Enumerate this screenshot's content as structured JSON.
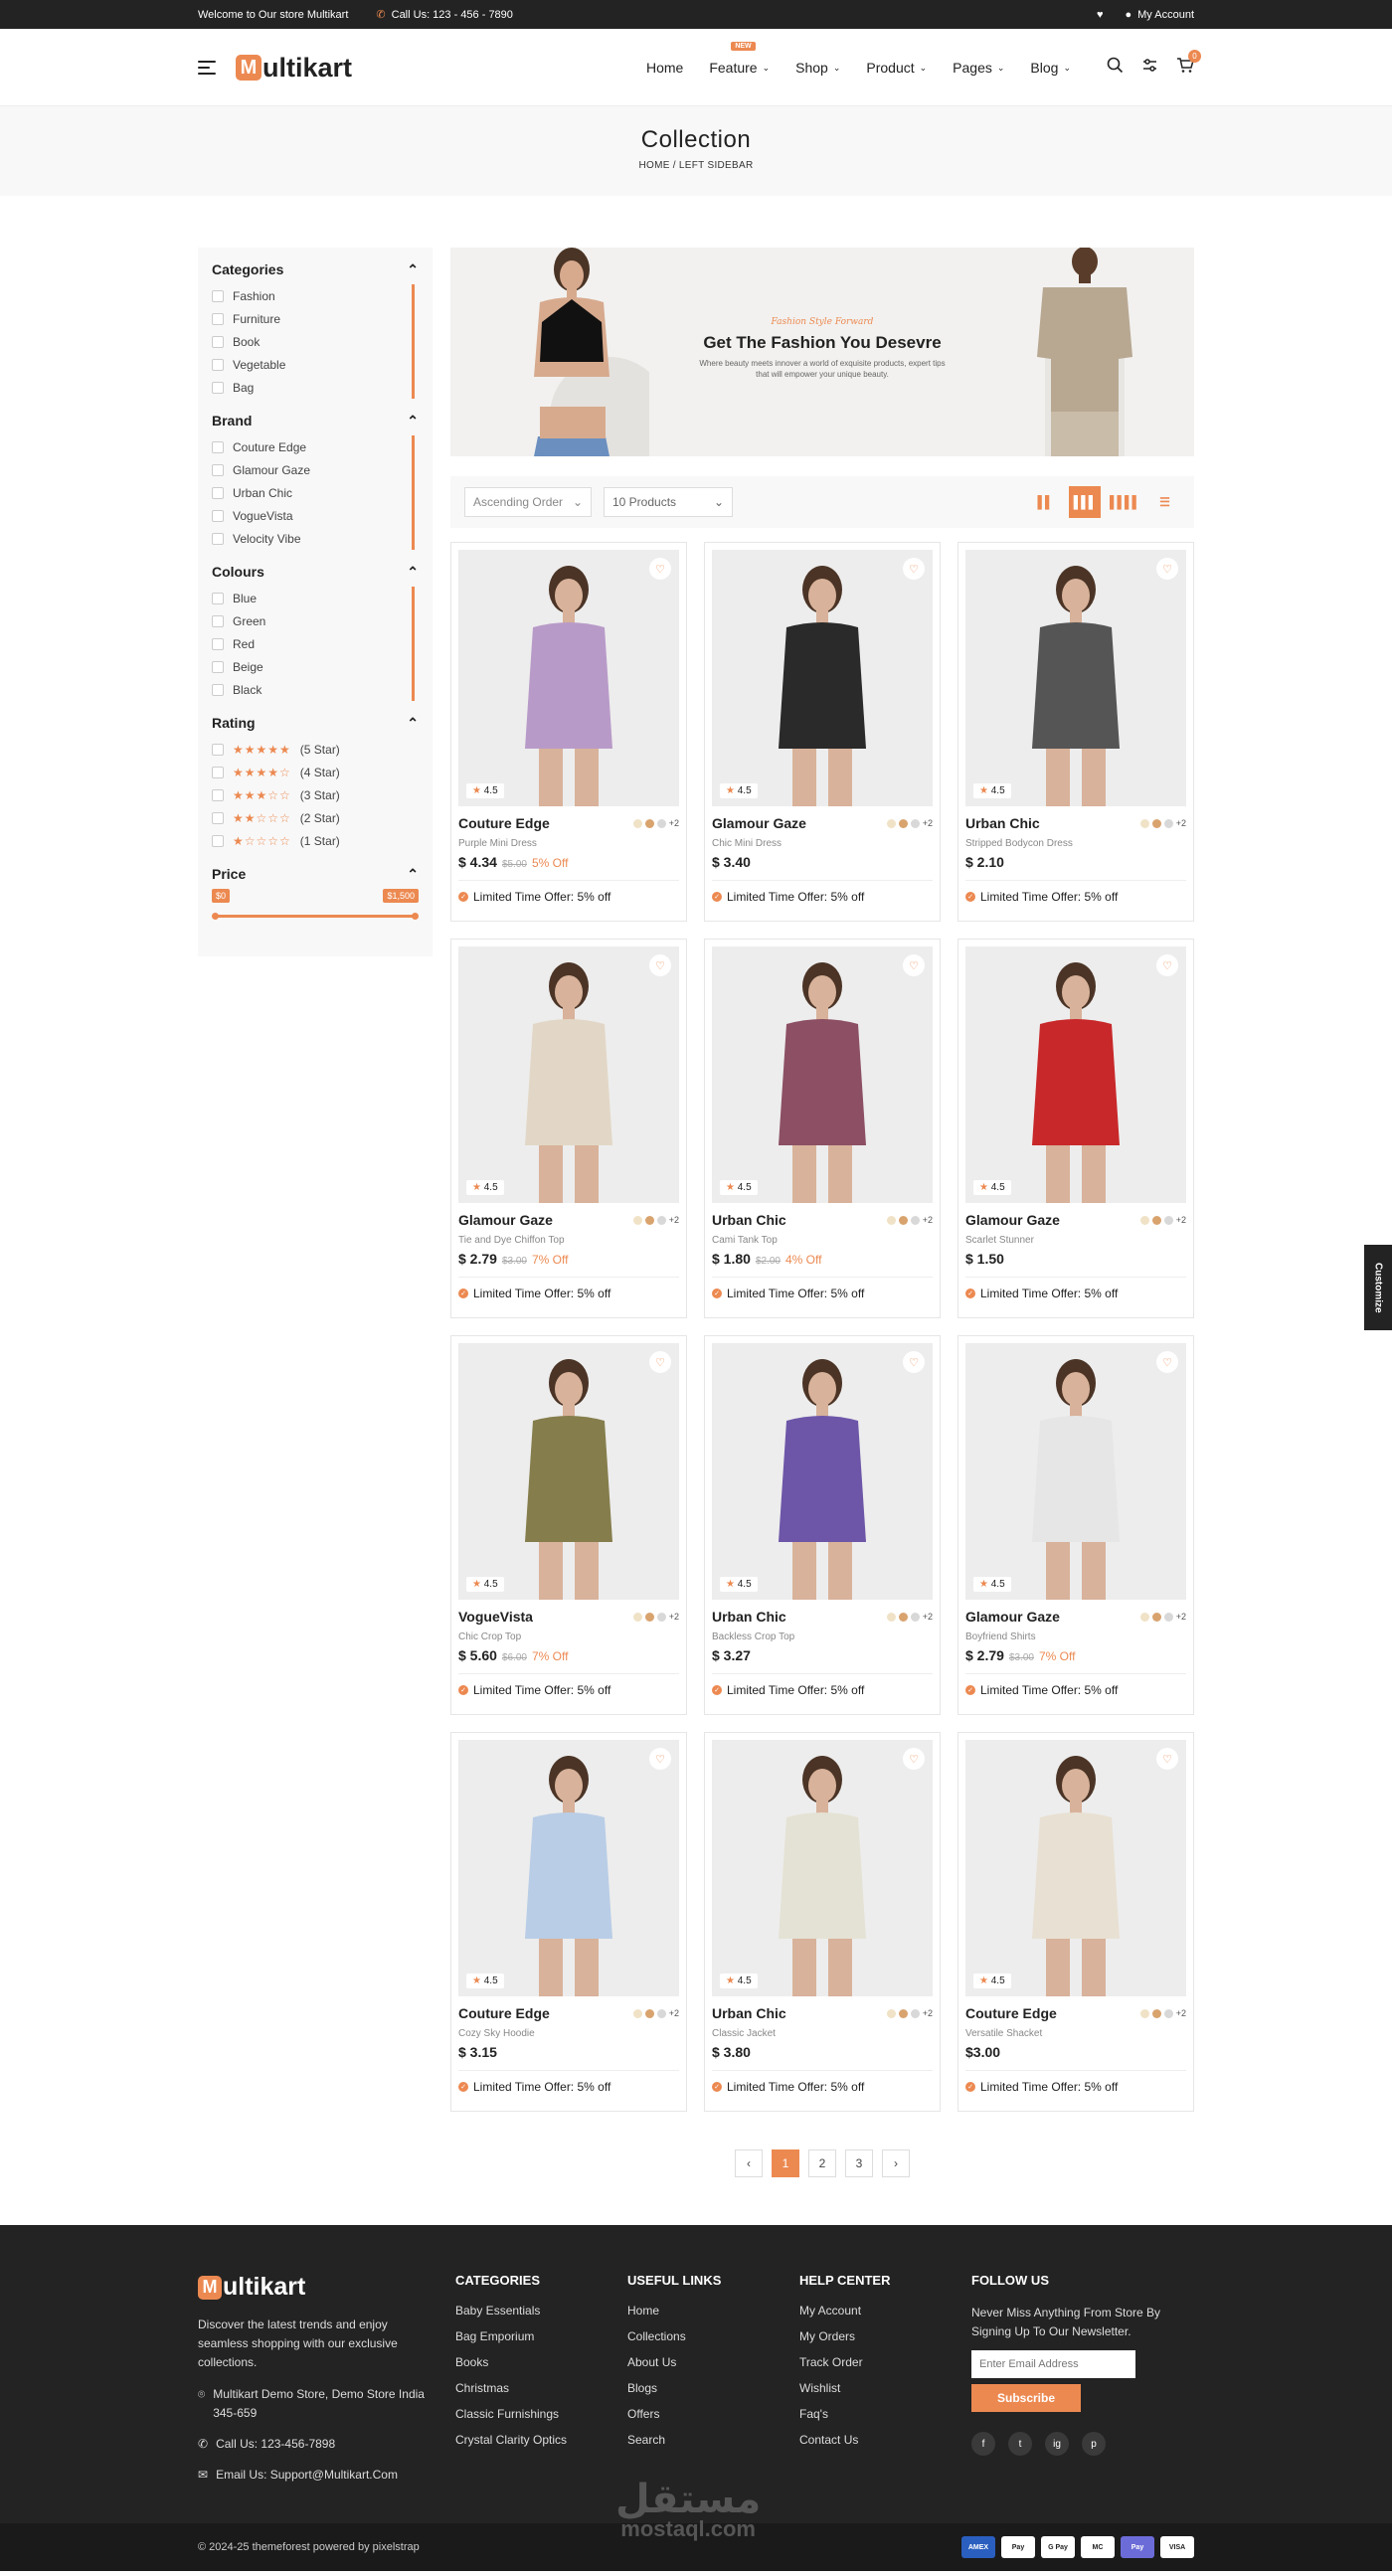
{
  "topbar": {
    "welcome": "Welcome to Our store Multikart",
    "phone": "Call Us: 123 - 456 - 7890",
    "account": "My Account"
  },
  "header": {
    "logo_rest": "ultikart",
    "nav": [
      {
        "label": "Home",
        "chevron": false,
        "badge": ""
      },
      {
        "label": "Feature",
        "chevron": true,
        "badge": "NEW"
      },
      {
        "label": "Shop",
        "chevron": true,
        "badge": ""
      },
      {
        "label": "Product",
        "chevron": true,
        "badge": ""
      },
      {
        "label": "Pages",
        "chevron": true,
        "badge": ""
      },
      {
        "label": "Blog",
        "chevron": true,
        "badge": ""
      }
    ],
    "cart_count": "0"
  },
  "page": {
    "title": "Collection",
    "breadcrumb": "HOME  /  LEFT SIDEBAR"
  },
  "filters": {
    "categories": {
      "title": "Categories",
      "items": [
        "Fashion",
        "Furniture",
        "Book",
        "Vegetable",
        "Bag"
      ]
    },
    "brand": {
      "title": "Brand",
      "items": [
        "Couture Edge",
        "Glamour Gaze",
        "Urban Chic",
        "VogueVista",
        "Velocity Vibe"
      ]
    },
    "colours": {
      "title": "Colours",
      "items": [
        "Blue",
        "Green",
        "Red",
        "Beige",
        "Black"
      ]
    },
    "rating": {
      "title": "Rating",
      "items": [
        {
          "stars": 5,
          "label": "(5 Star)"
        },
        {
          "stars": 4,
          "label": "(4 Star)"
        },
        {
          "stars": 3,
          "label": "(3 Star)"
        },
        {
          "stars": 2,
          "label": "(2 Star)"
        },
        {
          "stars": 1,
          "label": "(1 Star)"
        }
      ]
    },
    "price": {
      "title": "Price",
      "min": "$0",
      "max": "$1,500"
    }
  },
  "banner": {
    "script": "Fashion Style Forward",
    "title": "Get The Fashion You Desevre",
    "text": "Where beauty meets innover a world of exquisite products, expert tips that will empower your unique beauty."
  },
  "toolbar": {
    "sort": "Ascending Order",
    "count": "10 Products"
  },
  "products": [
    {
      "brand": "Couture Edge",
      "name": "Purple Mini Dress",
      "price": "$ 4.34",
      "old": "$5.00",
      "off": "5% Off",
      "rating": "4.5",
      "bg": "#b89ac8",
      "more": "+2",
      "offer": "Limited Time Offer: 5% off"
    },
    {
      "brand": "Glamour Gaze",
      "name": "Chic Mini Dress",
      "price": "$ 3.40",
      "old": "",
      "off": "",
      "rating": "4.5",
      "bg": "#2a2a2a",
      "more": "+2",
      "offer": "Limited Time Offer: 5% off"
    },
    {
      "brand": "Urban Chic",
      "name": "Stripped Bodycon Dress",
      "price": "$ 2.10",
      "old": "",
      "off": "",
      "rating": "4.5",
      "bg": "#555555",
      "more": "+2",
      "offer": "Limited Time Offer: 5% off"
    },
    {
      "brand": "Glamour Gaze",
      "name": "Tie and Dye Chiffon Top",
      "price": "$ 2.79",
      "old": "$3.00",
      "off": "7% Off",
      "rating": "4.5",
      "bg": "#e2d7c6",
      "more": "+2",
      "offer": "Limited Time Offer: 5% off"
    },
    {
      "brand": "Urban Chic",
      "name": "Cami Tank Top",
      "price": "$ 1.80",
      "old": "$2.00",
      "off": "4% Off",
      "rating": "4.5",
      "bg": "#8c4f63",
      "more": "+2",
      "offer": "Limited Time Offer: 5% off"
    },
    {
      "brand": "Glamour Gaze",
      "name": "Scarlet Stunner",
      "price": "$ 1.50",
      "old": "",
      "off": "",
      "rating": "4.5",
      "bg": "#c8282a",
      "more": "+2",
      "offer": "Limited Time Offer: 5% off"
    },
    {
      "brand": "VogueVista",
      "name": "Chic Crop Top",
      "price": "$ 5.60",
      "old": "$6.00",
      "off": "7% Off",
      "rating": "4.5",
      "bg": "#857d4c",
      "more": "+2",
      "offer": "Limited Time Offer: 5% off"
    },
    {
      "brand": "Urban Chic",
      "name": "Backless Crop Top",
      "price": "$ 3.27",
      "old": "",
      "off": "",
      "rating": "4.5",
      "bg": "#6d56a8",
      "more": "+2",
      "offer": "Limited Time Offer: 5% off"
    },
    {
      "brand": "Glamour Gaze",
      "name": "Boyfriend Shirts",
      "price": "$ 2.79",
      "old": "$3.00",
      "off": "7% Off",
      "rating": "4.5",
      "bg": "#e6e6e6",
      "more": "+2",
      "offer": "Limited Time Offer: 5% off"
    },
    {
      "brand": "Couture Edge",
      "name": "Cozy Sky Hoodie",
      "price": "$ 3.15",
      "old": "",
      "off": "",
      "rating": "4.5",
      "bg": "#b9cde6",
      "more": "+2",
      "offer": "Limited Time Offer: 5% off"
    },
    {
      "brand": "Urban Chic",
      "name": "Classic Jacket",
      "price": "$ 3.80",
      "old": "",
      "off": "",
      "rating": "4.5",
      "bg": "#e4e2d4",
      "more": "+2",
      "offer": "Limited Time Offer: 5% off"
    },
    {
      "brand": "Couture Edge",
      "name": "Versatile Shacket",
      "price": "$3.00",
      "old": "",
      "off": "",
      "rating": "4.5",
      "bg": "#e8e0d2",
      "more": "+2",
      "offer": "Limited Time Offer: 5% off"
    }
  ],
  "pagination": {
    "prev": "‹",
    "pages": [
      "1",
      "2",
      "3"
    ],
    "next": "›"
  },
  "customize": "Customize",
  "footer": {
    "logo_rest": "ultikart",
    "desc": "Discover the latest trends and enjoy seamless shopping with our exclusive collections.",
    "address": "Multikart Demo Store, Demo Store India 345-659",
    "phone": "Call Us: 123-456-7898",
    "email": "Email Us: Support@Multikart.Com",
    "categories": {
      "title": "CATEGORIES",
      "links": [
        "Baby Essentials",
        "Bag Emporium",
        "Books",
        "Christmas",
        "Classic Furnishings",
        "Crystal Clarity Optics"
      ]
    },
    "useful": {
      "title": "USEFUL LINKS",
      "links": [
        "Home",
        "Collections",
        "About Us",
        "Blogs",
        "Offers",
        "Search"
      ]
    },
    "help": {
      "title": "HELP CENTER",
      "links": [
        "My Account",
        "My Orders",
        "Track Order",
        "Wishlist",
        "Faq's",
        "Contact Us"
      ]
    },
    "follow": {
      "title": "FOLLOW US",
      "text": "Never Miss Anything From Store By Signing Up To Our Newsletter.",
      "placeholder": "Enter Email Address",
      "button": "Subscribe",
      "socials": [
        "f",
        "t",
        "ig",
        "p"
      ]
    },
    "copyright": "© 2024-25 themeforest powered by pixelstrap",
    "payments": [
      "AMEX",
      "Pay",
      "G Pay",
      "MC",
      "Pay",
      "VISA"
    ]
  },
  "watermark": {
    "ar": "مستقل",
    "en": "mostaql.com"
  }
}
